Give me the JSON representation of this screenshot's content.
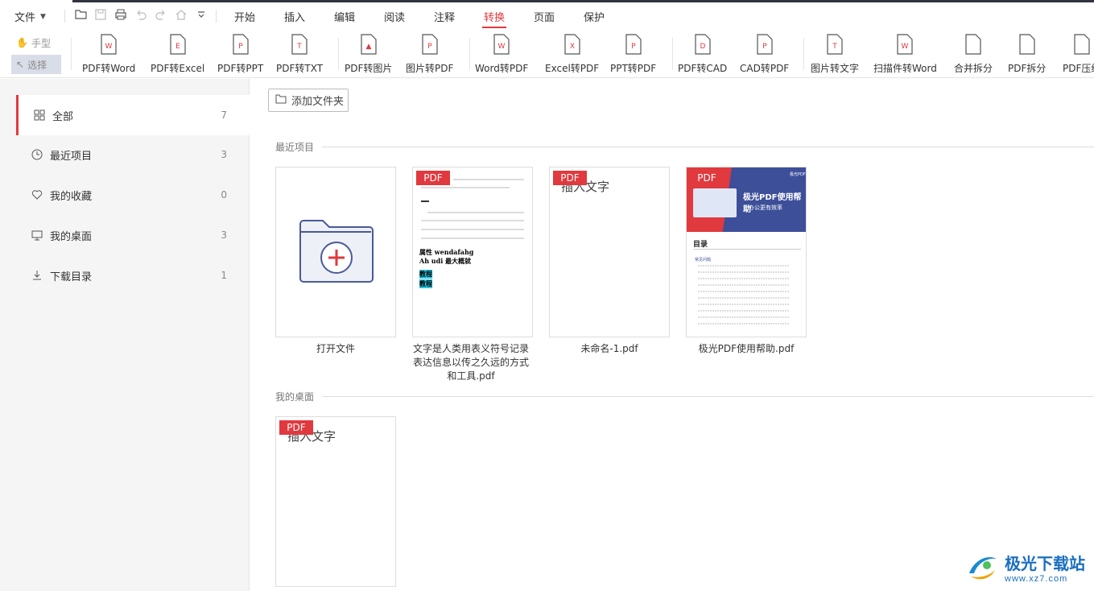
{
  "menu": {
    "file_label": "文件",
    "tabs": [
      "开始",
      "插入",
      "编辑",
      "阅读",
      "注释",
      "转换",
      "页面",
      "保护"
    ],
    "active_tab": "转换"
  },
  "toolbar": {
    "hand_label": "手型",
    "select_label": "选择",
    "tools": [
      "PDF转Word",
      "PDF转Excel",
      "PDF转PPT",
      "PDF转TXT",
      "PDF转图片",
      "图片转PDF",
      "Word转PDF",
      "Excel转PDF",
      "PPT转PDF",
      "PDF转CAD",
      "CAD转PDF",
      "图片转文字",
      "扫描件转Word",
      "合并拆分",
      "PDF拆分",
      "PDF压缩"
    ]
  },
  "sidebar": {
    "items": [
      {
        "label": "全部",
        "count": "7"
      },
      {
        "label": "最近项目",
        "count": "3"
      },
      {
        "label": "我的收藏",
        "count": "0"
      },
      {
        "label": "我的桌面",
        "count": "3"
      },
      {
        "label": "下载目录",
        "count": "1"
      }
    ]
  },
  "main": {
    "add_folder_label": "添加文件夹",
    "recent_section": "最近项目",
    "desktop_section": "我的桌面",
    "open_file_label": "打开文件",
    "pdf_badge": "PDF",
    "recent_files": [
      {
        "name": "文字是人类用表义符号记录表达信息以传之久远的方式和工具.pdf"
      },
      {
        "name": "未命名-1.pdf"
      },
      {
        "name": "极光PDF使用帮助.pdf"
      }
    ],
    "thumb_text_insert": "插入文字",
    "doc_thumb": {
      "line_a": "属性 wendafahg",
      "line_b": "Ah udi 最大概就",
      "highlight_1": "教程",
      "highlight_2": "教程"
    },
    "help_thumb": {
      "brand": "极光PDF",
      "title": "极光PDF使用帮助",
      "subtitle": "让办公更有效率",
      "toc_title": "目录",
      "toc_section": "常见问题"
    }
  },
  "watermark": {
    "title": "极光下载站",
    "url": "www.xz7.com"
  },
  "colors": {
    "accent": "#e0393e",
    "nav_blue": "#4a5a99"
  }
}
